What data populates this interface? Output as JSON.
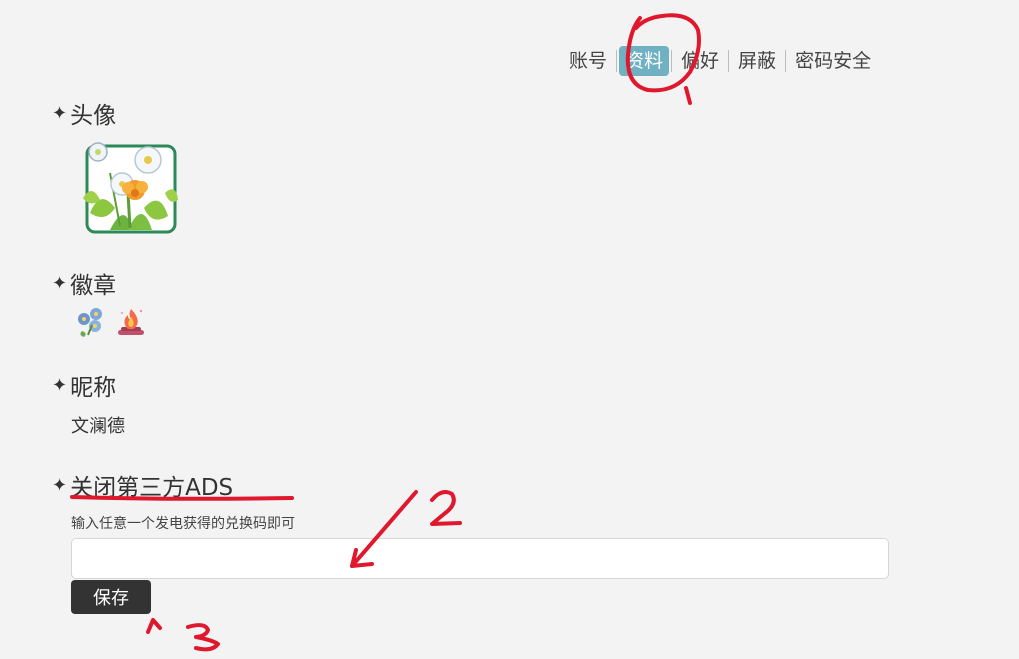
{
  "tabs": [
    {
      "label": "账号",
      "active": false
    },
    {
      "label": "资料",
      "active": true
    },
    {
      "label": "偏好",
      "active": false
    },
    {
      "label": "屏蔽",
      "active": false
    },
    {
      "label": "密码安全",
      "active": false
    }
  ],
  "sections": {
    "avatar": {
      "title": "头像"
    },
    "badges": {
      "title": "徽章",
      "items": [
        "forget-me-not-badge-icon",
        "campfire-badge-icon"
      ]
    },
    "nickname": {
      "title": "昵称",
      "value": "文澜德"
    },
    "ads": {
      "title": "关闭第三方ADS",
      "hint": "输入任意一个发电获得的兑换码即可",
      "input_value": "",
      "input_placeholder": "",
      "save_label": "保存"
    }
  },
  "annotations": {
    "color": "#e0182d",
    "numbers": [
      "1",
      "2",
      "3"
    ]
  },
  "colors": {
    "active_tab": "#6fb0c2",
    "background": "#f3f3f3",
    "button": "#333333"
  }
}
